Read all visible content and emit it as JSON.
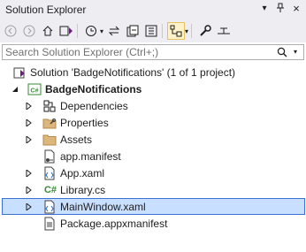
{
  "window": {
    "title": "Solution Explorer",
    "controls": {
      "dropdown": "▾",
      "pin": "⊥",
      "close": "×"
    }
  },
  "toolbar": {
    "buttons": [
      "back-icon",
      "forward-icon",
      "home-icon",
      "vs-switch-icon",
      "history-icon",
      "sync-icon",
      "collapse-all-icon",
      "show-all-files-icon",
      "filter-icon",
      "properties-icon",
      "preview-icon"
    ],
    "dropdown_glyph": "▾"
  },
  "search": {
    "placeholder": "Search Solution Explorer (Ctrl+;)",
    "value": ""
  },
  "tree": {
    "solution": {
      "label": "Solution 'BadgeNotifications' (1 of 1 project)"
    },
    "project": {
      "label": "BadgeNotifications",
      "badge": "C#"
    },
    "items": [
      {
        "label": "Dependencies",
        "icon": "dependencies-icon",
        "expandable": true
      },
      {
        "label": "Properties",
        "icon": "properties-folder-icon",
        "expandable": true
      },
      {
        "label": "Assets",
        "icon": "folder-icon",
        "expandable": true
      },
      {
        "label": "app.manifest",
        "icon": "manifest-file-icon",
        "expandable": false
      },
      {
        "label": "App.xaml",
        "icon": "xaml-file-icon",
        "expandable": true
      },
      {
        "label": "Library.cs",
        "icon": "csharp-file-icon",
        "expandable": true,
        "badge": "C#"
      },
      {
        "label": "MainWindow.xaml",
        "icon": "xaml-file-icon",
        "expandable": true,
        "selected": true
      },
      {
        "label": "Package.appxmanifest",
        "icon": "appxmanifest-file-icon",
        "expandable": false
      }
    ]
  },
  "colors": {
    "accent": "#3a72d1",
    "selection": "#c9dfff",
    "chrome": "#eeeef2",
    "csharp": "#388a34"
  }
}
